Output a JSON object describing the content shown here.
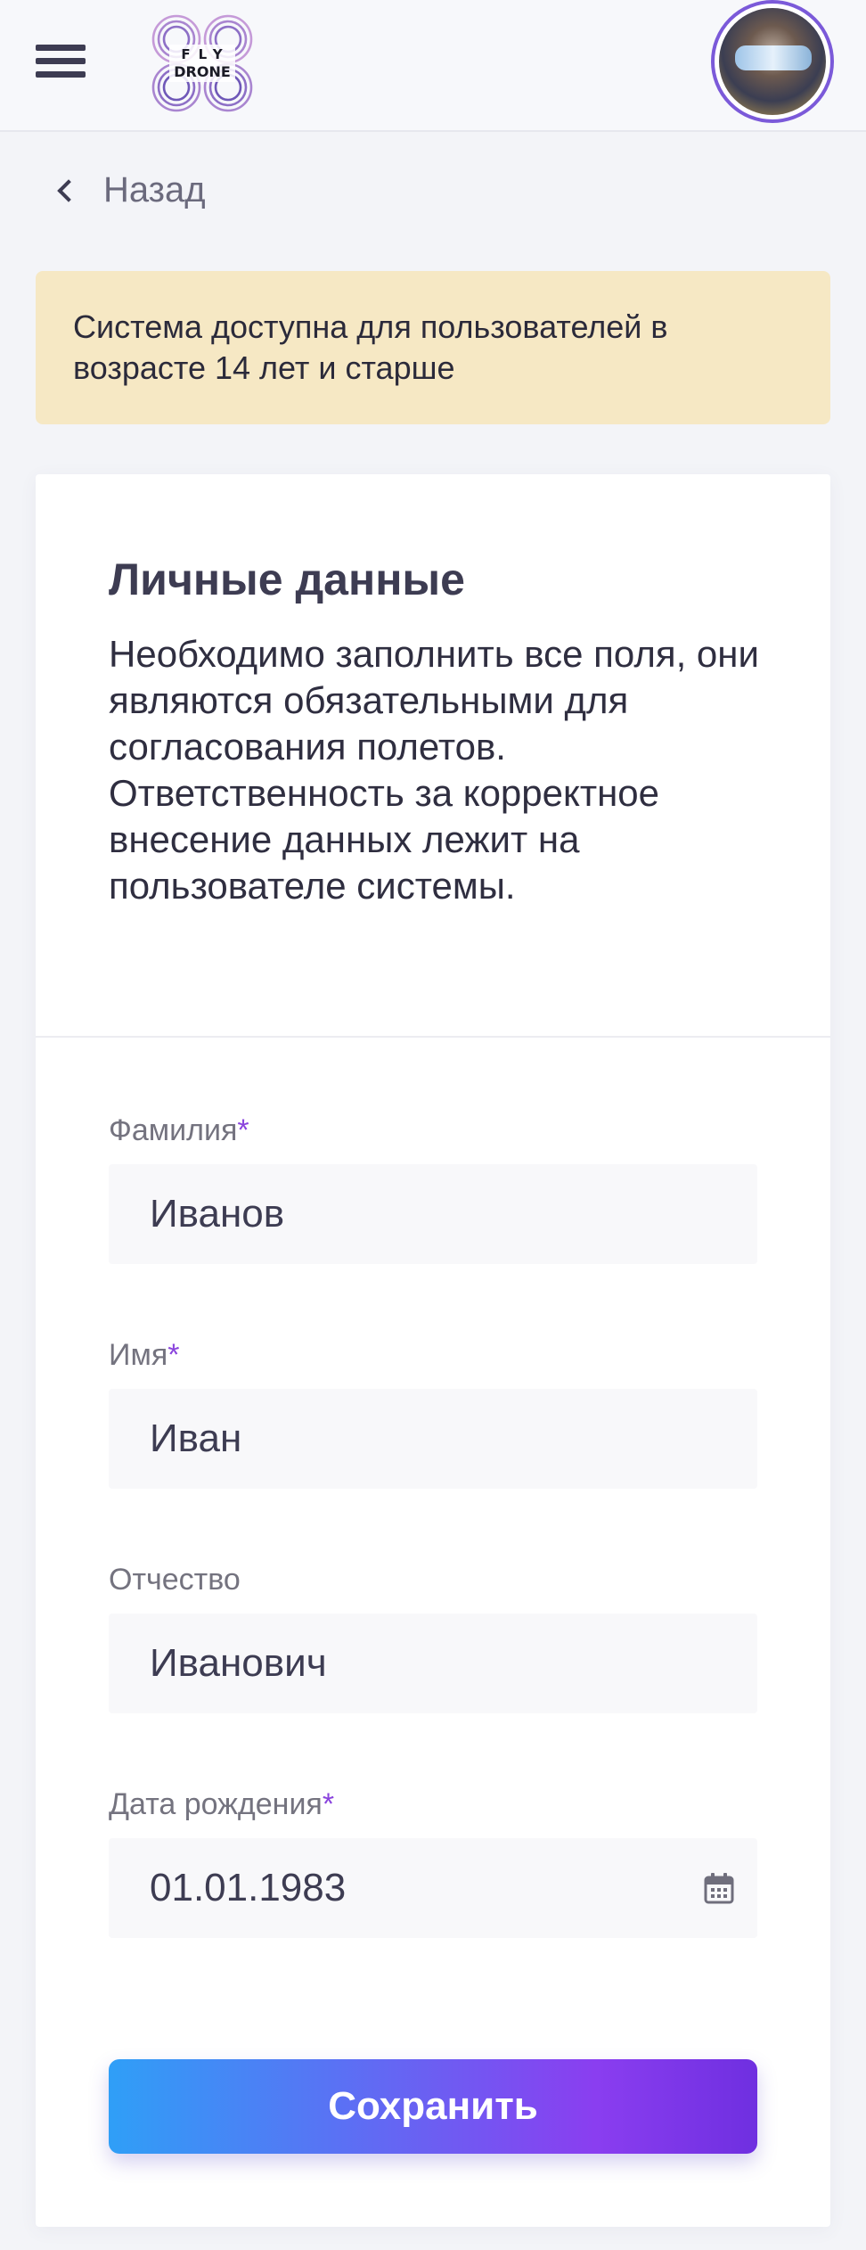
{
  "header": {
    "menu_icon": "hamburger-icon",
    "logo": {
      "line1": "FLY",
      "line2": "DRONE"
    },
    "avatar": "user-avatar"
  },
  "nav": {
    "back_label": "Назад",
    "back_icon": "chevron-left-icon"
  },
  "notice": {
    "text": "Система доступна для пользователей в возрасте 14 лет и старше",
    "background": "#f6e8c4"
  },
  "card": {
    "title": "Личные данные",
    "description": "Необходимо заполнить все поля, они являются обязательными для согласования полетов. Ответственность за корректное внесение данных лежит на пользователе системы."
  },
  "form": {
    "last_name": {
      "label": "Фамилия",
      "required_mark": "*",
      "value": "Иванов"
    },
    "first_name": {
      "label": "Имя",
      "required_mark": "*",
      "value": "Иван"
    },
    "patronymic": {
      "label": "Отчество",
      "value": "Иванович"
    },
    "birth_date": {
      "label": "Дата рождения",
      "required_mark": "*",
      "value": "01.01.1983",
      "icon": "calendar-icon"
    },
    "save_label": "Сохранить"
  },
  "colors": {
    "accent": "#8a44dd",
    "button_gradient_start": "#2f9ff7",
    "button_gradient_end": "#6f2fe0",
    "page_background": "#f3f4f8"
  }
}
